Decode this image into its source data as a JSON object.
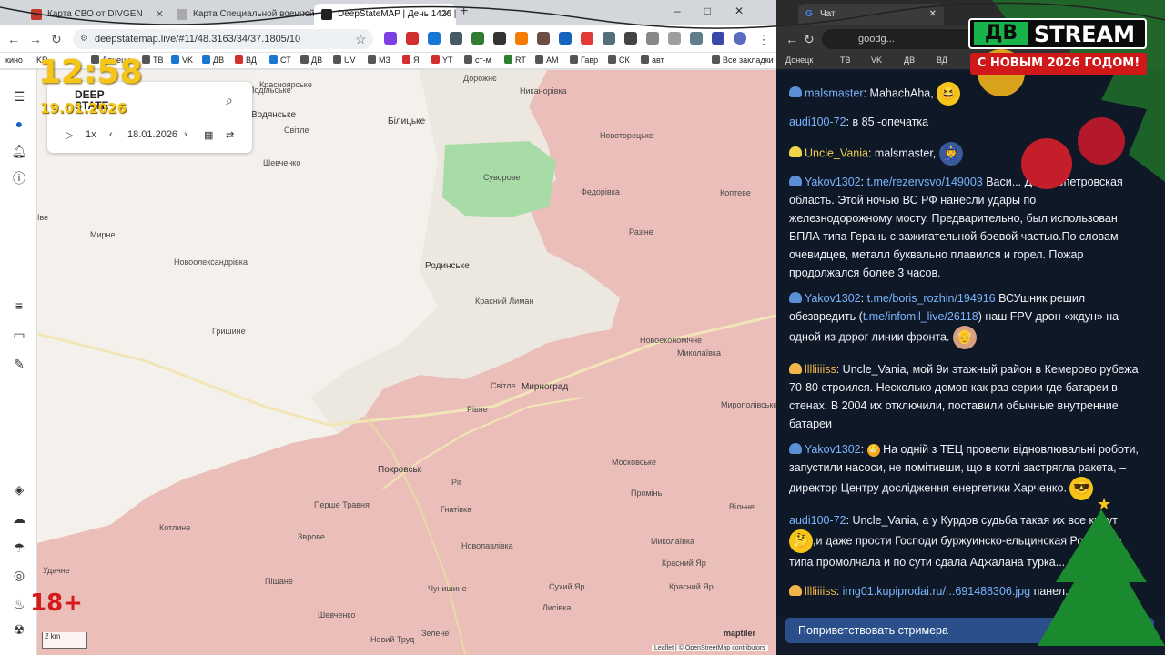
{
  "left_window": {
    "tabs": [
      {
        "label": "Карта СВО от DIVGEN",
        "color": "#c0392b"
      },
      {
        "label": "Карта Специальной военной",
        "color": "#888888"
      },
      {
        "label": "DeepStateMAP | День 1426 | М",
        "color": "#222222"
      }
    ],
    "url": "deepstatemap.live/#11/48.3163/34/37.1805/10",
    "bookmarks": [
      "кино",
      "KR",
      "Донецк",
      "ТВ",
      "VK",
      "ДВ",
      "ВД",
      "СТ",
      "ДВ",
      "UV",
      "МЗ",
      "Я",
      "YT",
      "ст-м",
      "RT",
      "AM",
      "Гавр",
      "СК",
      "авт",
      "Все закладки"
    ]
  },
  "stream_clock": {
    "time": "12:58",
    "date": "19.01.2026"
  },
  "deepstate_panel": {
    "logo_line1": "DEEP",
    "logo_line2": "STATE",
    "speed": "1x",
    "date": "18.01.2026"
  },
  "age_rating": "18+",
  "map": {
    "places": [
      "Дорожнє",
      "Никанорівка",
      "Красноярське",
      "Подільське",
      "Водянське",
      "Білицьке",
      "Новоторецьке",
      "Світле",
      "Суворове",
      "Шевченко",
      "Федорівка",
      "Коптеве",
      "Мирне",
      "Разіне",
      "Новоолександрівка",
      "Родинське",
      "Красний Лиман",
      "Гришине",
      "Новоекономічне",
      "Миколаївка",
      "Світле",
      "Мирноград",
      "Мирополівське",
      "Рівне",
      "Покровськ",
      "Московське",
      "Перше Травня",
      "Ріг",
      "Гнатівка",
      "Промінь",
      "Котлине",
      "Зврове",
      "Новопавлівка",
      "Миколаївка",
      "Удачне",
      "Піщане",
      "Чунишине",
      "Красний Яр",
      "Сухий Яр",
      "Красний Яр",
      "Лисівка",
      "Шевченко",
      "Новий Труд",
      "Зелене",
      "Іве",
      "Вільне"
    ],
    "scale_label": "2 km",
    "attribution": "Leaflet | © OpenStreetMap contributors",
    "provider": "maptiler"
  },
  "right_window": {
    "tab_title": "Чат",
    "url": "goodg...",
    "bookmarks": [
      "Донецк",
      "ТВ",
      "VK",
      "ДВ",
      "ВД"
    ]
  },
  "stream_overlay": {
    "logo_db": "ДВ",
    "logo_stream": "STREAM",
    "greeting": "С НОВЫМ 2026 ГОДОМ!"
  },
  "chat": {
    "messages": [
      {
        "user": "malsmaster",
        "sep": ": ",
        "text": "MahachAha,"
      },
      {
        "user": "audi100-72",
        "sep": ": ",
        "text": "в 85 -опечатка"
      },
      {
        "user": "Uncle_Vania",
        "sep": ": ",
        "text": "malsmaster,"
      },
      {
        "user": "Yakov1302",
        "sep": ": ",
        "link": "t.me/rezervsvo/149003",
        "text": "Васи... Днепропетровская область. Этой ночью ВС РФ нанесли удары по железнодорожному мосту. Предварительно, был использован БПЛА типа Герань с зажигательной боевой частью.По словам очевидцев, металл буквально плавился и горел. Пожар продолжался более 3 часов."
      },
      {
        "user": "Yakov1302",
        "sep": ": ",
        "link": "t.me/boris_rozhin/194916",
        "text": "ВСУшник решил обезвредить (",
        "link2": "t.me/infomil_live/26118",
        "text2": ") наш FPV-дрон «ждун» на одной из дорог линии фронта."
      },
      {
        "user": "lllliiiiss",
        "sep": ": ",
        "text": "Uncle_Vania, мой 9и этажный район в Кемерово рубежа 70-80 строился. Несколько домов как раз серии где батареи в стенах. В 2004 их отключили, поставили обычные внутренние батареи"
      },
      {
        "user": "Yakov1302",
        "sep": ": ",
        "text": "На одній з ТЕЦ провели відновлювальні роботи, запустили насоси, не помітивши, що в котлі застрягла ракета, – директор Центру дослідження енергетики Харченко."
      },
      {
        "user": "audi100-72",
        "sep": ": ",
        "text": "Uncle_Vania, а у Курдов судьба такая их все кинут",
        "text2": ",и даже прости Господи буржуинско-ельцинская Ро... дело типа промолчала и по сути сдала Аджалана турка..."
      },
      {
        "user": "lllliiiiss",
        "sep": ": ",
        "link": "img01.kupiprodai.ru/...691488306.jpg",
        "text": "панел..."
      }
    ],
    "greet_button": "Поприветствовать стримера"
  }
}
